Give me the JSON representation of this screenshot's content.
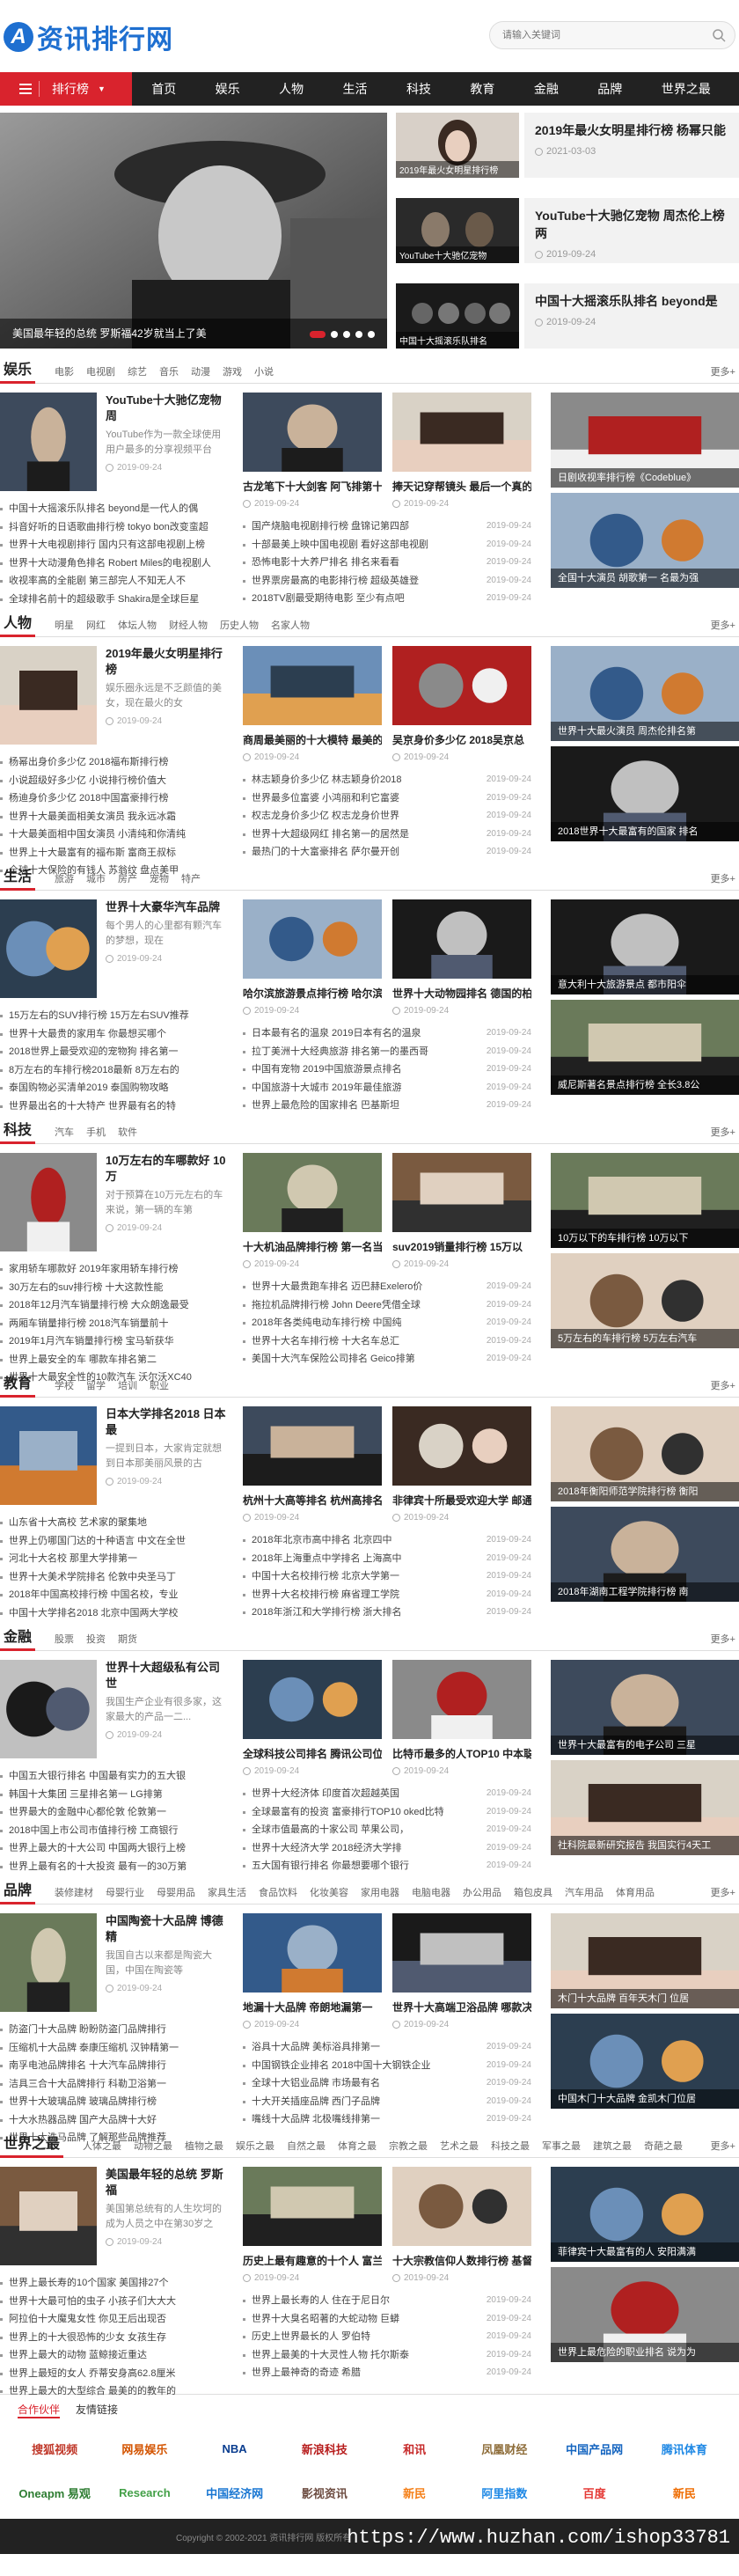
{
  "site": {
    "logo_mark": "A",
    "logo_text": "资讯排行网",
    "search_placeholder": "请输入关键词"
  },
  "nav": {
    "category_label": "排行榜",
    "items": [
      "首页",
      "娱乐",
      "人物",
      "生活",
      "科技",
      "教育",
      "金融",
      "品牌",
      "世界之最"
    ]
  },
  "hero": {
    "main_caption": "美国最年轻的总统 罗斯福42岁就当上了美",
    "thumbs": [
      "2019年最火女明星排行榜",
      "YouTube十大驰亿宠物",
      "中国十大摇滚乐队排名"
    ],
    "side": [
      {
        "title": "2019年最火女明星排行榜 杨幂只能",
        "date": "2021-03-03"
      },
      {
        "title": "YouTube十大驰亿宠物 周杰伦上榜两",
        "date": "2019-09-24"
      },
      {
        "title": "中国十大摇滚乐队排名 beyond是",
        "date": "2019-09-24"
      }
    ]
  },
  "more": "更多+",
  "sections": [
    {
      "title": "娱乐",
      "tags": [
        "电影",
        "电视剧",
        "综艺",
        "音乐",
        "动漫",
        "游戏",
        "小说"
      ],
      "feat": {
        "title": "YouTube十大驰亿宠物 周",
        "desc": "YouTube作为一款全球使用用户最多的分享视频平台",
        "date": "2019-09-24"
      },
      "list": [
        "中国十大摇滚乐队排名 beyond是一代人的偶",
        "抖音好听的日语歌曲排行榜 tokyo bon改变蛮超",
        "世界十大电视剧排行 国内只有这部电视剧上榜",
        "世界十大动漫角色排名 Robert Miles的电视剧人",
        "收视率高的全能剧 第三部完人不知无人不",
        "全球排名前十的超级歌手 Shakira是全球巨星"
      ],
      "cards": [
        {
          "title": "古龙笔下十大剑客 阿飞排第十",
          "date": "2019-09-24"
        },
        {
          "title": "捧天记穿帮镜头 最后一个真的",
          "date": "2019-09-24"
        }
      ],
      "dlist": [
        {
          "t": "国产烧脑电视剧排行榜 盘锦记第四部",
          "d": "2019-09-24"
        },
        {
          "t": "十部最美上映中国电视剧 看好这部电视剧",
          "d": "2019-09-24"
        },
        {
          "t": "恐怖电影十大养尸排名 排名来看看",
          "d": "2019-09-24"
        },
        {
          "t": "世界票房最高的电影排行榜 超级英雄登",
          "d": "2019-09-24"
        },
        {
          "t": "2018TV剧最受期待电影 至少有点吧",
          "d": "2019-09-24"
        }
      ],
      "bigs": [
        "日剧收视率排行榜《Codeblue》",
        "全国十大演员 胡歌第一 名最为强"
      ]
    },
    {
      "title": "人物",
      "tags": [
        "明星",
        "网红",
        "体坛人物",
        "财经人物",
        "历史人物",
        "名家人物"
      ],
      "feat": {
        "title": "2019年最火女明星排行榜",
        "desc": "娱乐圈永远是不乏颜值的美女，现在最火的女",
        "date": "2019-09-24"
      },
      "list": [
        "杨幂出身价多少亿 2018福布斯排行榜",
        "小说超级好多少亿 小说排行榜价值大",
        "杨迪身价多少亿 2018中国富豪排行榜",
        "世界十大最美面相美女演员 我永远冰霜",
        "十大最美面相中国女演员 小清纯和你清纯",
        "世界上十大最富有的福布斯 富商王叔标",
        "全球十大保险的有钱人 苏翁纹 盘点美甲"
      ],
      "cards": [
        {
          "title": "商周最美丽的十大模特 最美的",
          "date": "2019-09-24"
        },
        {
          "title": "吴京身价多少亿 2018吴京总",
          "date": "2019-09-24"
        }
      ],
      "dlist": [
        {
          "t": "林志颖身价多少亿 林志颖身价2018",
          "d": "2019-09-24"
        },
        {
          "t": "世界最多位富婆 小鸿丽和利它富婆",
          "d": "2019-09-24"
        },
        {
          "t": "权志龙身价多少亿 权志龙身价世界",
          "d": "2019-09-24"
        },
        {
          "t": "世界十大超级网红 排名第一的居然是",
          "d": "2019-09-24"
        },
        {
          "t": "最热门的十大富豪排名 萨尔曼开创",
          "d": "2019-09-24"
        }
      ],
      "bigs": [
        "世界十大最火演员 周杰伦排名第",
        "2018世界十大最富有的国家 排名"
      ]
    },
    {
      "title": "生活",
      "tags": [
        "旅游",
        "城市",
        "房产",
        "宠物",
        "特产"
      ],
      "feat": {
        "title": "世界十大豪华汽车品牌",
        "desc": "每个男人的心里都有颗汽车的梦想，现在",
        "date": "2019-09-24"
      },
      "list": [
        "15万左右的SUV排行榜 15万左右SUV推荐",
        "世界十大最贵的家用车 你最想买哪个",
        "2018世界上最受欢迎的宠物狗 排名第一",
        "8万左右的车排行榜2018最新 8万左右的",
        "泰国购物必买清单2019 泰国购物攻略",
        "世界最出名的十大特产 世界最有名的特"
      ],
      "cards": [
        {
          "title": "哈尔滨旅游景点排行榜 哈尔滨",
          "date": "2019-09-24"
        },
        {
          "title": "世界十大动物园排名 德国的柏",
          "date": "2019-09-24"
        }
      ],
      "dlist": [
        {
          "t": "日本最有名的温泉 2019日本有名的温泉",
          "d": "2019-09-24"
        },
        {
          "t": "拉丁美洲十大经典旅游 排名第一的墨西哥",
          "d": "2019-09-24"
        },
        {
          "t": "中国有宠物 2019中国旅游景点排名",
          "d": "2019-09-24"
        },
        {
          "t": "中国旅游十大城市 2019年最佳旅游",
          "d": "2019-09-24"
        },
        {
          "t": "世界上最危险的国家排名 巴基斯坦",
          "d": "2019-09-24"
        }
      ],
      "bigs": [
        "意大利十大旅游景点 都市阳伞",
        "威尼斯著名景点排行榜 全长3.8公"
      ]
    },
    {
      "title": "科技",
      "tags": [
        "汽车",
        "手机",
        "软件"
      ],
      "feat": {
        "title": "10万左右的车哪款好 10万",
        "desc": "对于预算在10万元左右的车来说，第一辆的车第",
        "date": "2019-09-24"
      },
      "list": [
        "家用轿车哪款好 2019年家用轿车排行榜",
        "30万左右的suv排行榜 十大这款性能",
        "2018年12月汽车销量排行榜 大众朗逸最受",
        "两厢车销量排行榜 2018汽车销量前十",
        "2019年1月汽车销量排行榜 宝马斩获华",
        "世界上最安全的车 哪款车排名第二",
        "世界十大最安全性的10款汽车 沃尔沃XC40"
      ],
      "cards": [
        {
          "title": "十大机油品牌排行榜 第一名当",
          "date": "2019-09-24"
        },
        {
          "title": "suv2019销量排行榜 15万以",
          "date": "2019-09-24"
        }
      ],
      "dlist": [
        {
          "t": "世界十大最贵跑车排名 迈巴赫Exelero价",
          "d": "2019-09-24"
        },
        {
          "t": "拖拉机品牌排行榜 John Deere凭借全球",
          "d": "2019-09-24"
        },
        {
          "t": "2018年各类纯电动车排行榜 中国纯",
          "d": "2019-09-24"
        },
        {
          "t": "世界十大名车排行榜 十大名车总汇",
          "d": "2019-09-24"
        },
        {
          "t": "美国十大汽车保险公司排名 Geico排第",
          "d": "2019-09-24"
        }
      ],
      "bigs": [
        "10万以下的车排行榜 10万以下",
        "5万左右的车排行榜 5万左右汽车"
      ]
    },
    {
      "title": "教育",
      "tags": [
        "学校",
        "留学",
        "培训",
        "职业"
      ],
      "feat": {
        "title": "日本大学排名2018 日本最",
        "desc": "一提到日本，大家肯定就想到日本那美丽风景的古",
        "date": "2019-09-24"
      },
      "list": [
        "山东省十大高校 艺术家的聚集地",
        "世界上仍哪国门达的十种语言 中文在全世",
        "河北十大名校 那里大学排第一",
        "世界十大美术学院排名 伦敦中央圣马丁",
        "2018年中国高校排行榜 中国名校，专业",
        "中国十大学排名2018 北京中国两大学校"
      ],
      "cards": [
        {
          "title": "杭州十大高等排名 杭州高排名",
          "date": "2019-09-24"
        },
        {
          "title": "非律宾十所最受欢迎大学 邮通",
          "date": "2019-09-24"
        }
      ],
      "dlist": [
        {
          "t": "2018年北京市高中排名 北京四中",
          "d": "2019-09-24"
        },
        {
          "t": "2018年上海重点中学排名 上海高中",
          "d": "2019-09-24"
        },
        {
          "t": "中国十大名校排行榜 北京大学第一",
          "d": "2019-09-24"
        },
        {
          "t": "世界十大名校排行榜 麻省理工学院",
          "d": "2019-09-24"
        },
        {
          "t": "2018年浙江和大学排行榜 浙大排名",
          "d": "2019-09-24"
        }
      ],
      "bigs": [
        "2018年衡阳师范学院排行榜 衡阳",
        "2018年湖南工程学院排行榜 南"
      ]
    },
    {
      "title": "金融",
      "tags": [
        "股票",
        "投资",
        "期货"
      ],
      "feat": {
        "title": "世界十大超级私有公司 世",
        "desc": "我国生产企业有很多家，这家最大的产品一二...",
        "date": "2019-09-24"
      },
      "list": [
        "中国五大银行排名 中国最有实力的五大银",
        "韩国十大集团 三星排名第一 LG排第",
        "世界最大的金融中心都伦敦 伦敦第一",
        "2018中国上市公司市值排行榜 工商银行",
        "世界上最大的十大公司 中国两大银行上榜",
        "世界上最有名的十大投资 最有一的30万第"
      ],
      "cards": [
        {
          "title": "全球科技公司排名 腾讯公司位",
          "date": "2019-09-24"
        },
        {
          "title": "比特币最多的人TOP10 中本聪",
          "date": "2019-09-24"
        }
      ],
      "dlist": [
        {
          "t": "世界十大经济体 印度首次超越英国",
          "d": "2019-09-24"
        },
        {
          "t": "全球最富有的投资 富豪排行TOP10 oked比特",
          "d": "2019-09-24"
        },
        {
          "t": "全球市值最高的十家公司 苹果公司，",
          "d": "2019-09-24"
        },
        {
          "t": "世界十大经济大学 2018经济大学排",
          "d": "2019-09-24"
        },
        {
          "t": "五大国有银行排名 你最想要哪个银行",
          "d": "2019-09-24"
        }
      ],
      "bigs": [
        "世界十大最富有的电子公司 三星",
        "社科院最新研究报告 我国实行4天工"
      ]
    },
    {
      "title": "品牌",
      "tags": [
        "装修建材",
        "母婴行业",
        "母婴用品",
        "家具生活",
        "食品饮料",
        "化妆美容",
        "家用电器",
        "电脑电器",
        "办公用品",
        "箱包皮具",
        "汽车用品",
        "体育用品"
      ],
      "feat": {
        "title": "中国陶瓷十大品牌 博德精",
        "desc": "我国自古以来都是陶瓷大国，中国在陶瓷等",
        "date": "2019-09-24"
      },
      "list": [
        "防盗门十大品牌 盼盼防盗门品牌排行",
        "压缩机十大品牌 泰康压缩机 汉钟精第一",
        "南孚电池品牌排名 十大汽车品牌排行",
        "洁具三合十大品牌排行 科勒卫浴第一",
        "世界十大玻璃品牌 玻璃品牌排行榜",
        "十大水热器品牌 国产大品牌十大好",
        "世界十大洗马品牌 了解那些品牌推荐"
      ],
      "cards": [
        {
          "title": "地漏十大品牌 帝朗地漏第一",
          "date": "2019-09-24"
        },
        {
          "title": "世界十大高端卫浴品牌 哪款决",
          "date": "2019-09-24"
        }
      ],
      "dlist": [
        {
          "t": "浴具十大品牌 美标浴具排第一",
          "d": "2019-09-24"
        },
        {
          "t": "中国钢铁企业排名 2018中国十大钢铁企业",
          "d": "2019-09-24"
        },
        {
          "t": "全球十大铝业品牌 市场最有名",
          "d": "2019-09-24"
        },
        {
          "t": "十大开关插座品牌 西门子品牌",
          "d": "2019-09-24"
        },
        {
          "t": "嘴线十大品牌 北极嘴线排第一",
          "d": "2019-09-24"
        }
      ],
      "bigs": [
        "木门十大品牌 百年天木门 位居",
        "中国木门十大品牌 金凯木门位居"
      ]
    },
    {
      "title": "世界之最",
      "tags": [
        "人体之最",
        "动物之最",
        "植物之最",
        "娱乐之最",
        "自然之最",
        "体育之最",
        "宗教之最",
        "艺术之最",
        "科技之最",
        "军事之最",
        "建筑之最",
        "奇葩之最"
      ],
      "feat": {
        "title": "美国最年轻的总统 罗斯福",
        "desc": "美国第总统有的人生坎坷的成为人员之中在第30岁之前...",
        "date": "2019-09-24"
      },
      "list": [
        "世界上最长寿的10个国家 美国排27个",
        "世界十大最可怕的虫子 小孩子们大大大",
        "阿拉伯十大魔鬼女性 你见王后出现否",
        "世界上的十大很恐怖的少女 女孩生存",
        "世界上最大的动物 蓝鲸接近重达",
        "世界上最短的女人 乔蒂安身高62.8厘米",
        "世界上最大的大型综合 最美的的教年的"
      ],
      "cards": [
        {
          "title": "历史上最有趣意的十个人 富兰",
          "date": "2019-09-24"
        },
        {
          "title": "十大宗教信仰人数排行榜 基督",
          "date": "2019-09-24"
        }
      ],
      "dlist": [
        {
          "t": "世界上最长寿的人 住在于尼日尔",
          "d": "2019-09-24"
        },
        {
          "t": "世界十大臭名昭著的大蛇动物 巨蟒",
          "d": "2019-09-24"
        },
        {
          "t": "历史上世界最长的人 罗伯特",
          "d": "2019-09-24"
        },
        {
          "t": "世界上最美的十大灵性人物 托尔斯泰",
          "d": "2019-09-24"
        },
        {
          "t": "世界上最神奇的奇迹 希腊",
          "d": "2019-09-24"
        }
      ],
      "bigs": [
        "菲律宾十大最富有的人 安阳满满",
        "世界上最危险的职业排名 说为为"
      ]
    }
  ],
  "partners": {
    "tabs": [
      "合作伙伴",
      "友情链接"
    ],
    "logos": [
      "搜狐视频",
      "网易娱乐",
      "NBA",
      "新浪科技",
      "和讯",
      "凤凰财经",
      "中国产品网",
      "腾讯体育",
      "Oneapm 易观",
      "Research",
      "中国经济网",
      "影视资讯",
      "新民",
      "阿里指数",
      "百度",
      "新民"
    ]
  },
  "footer": {
    "copyright": "Copyright © 2002-2021 资讯排行网 版权所有",
    "watermark": "https://www.huzhan.com/ishop33781"
  }
}
